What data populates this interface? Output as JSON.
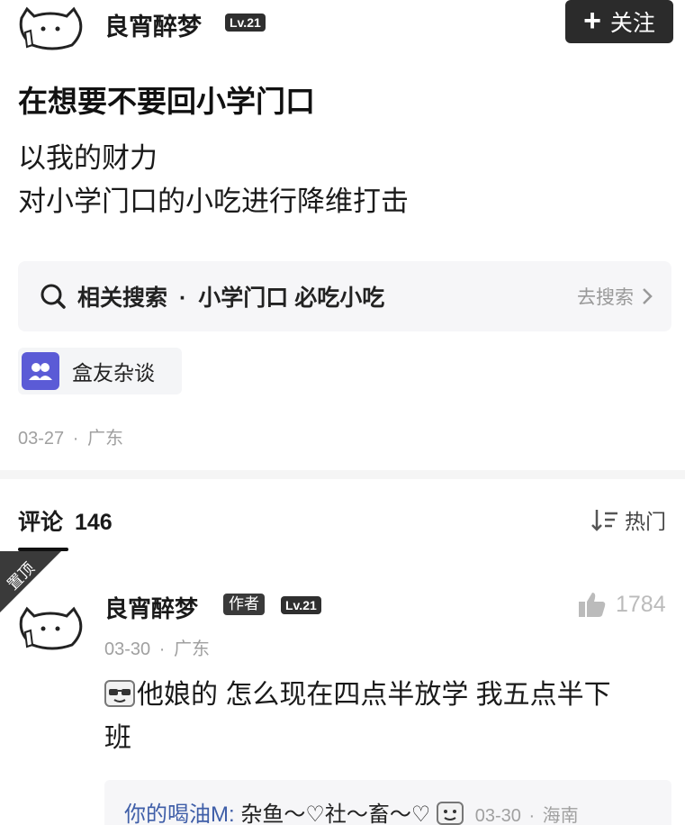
{
  "post": {
    "author": "良宵醉梦",
    "level": "Lv.21",
    "follow_label": "关注",
    "title": "在想要不要回小学门口",
    "body_lines": [
      "以我的财力",
      "对小学门口的小吃进行降维打击"
    ],
    "related_search": {
      "prefix": "相关搜索",
      "separator": "·",
      "query": "小学门口 必吃小吃",
      "action": "去搜索"
    },
    "topic": "盒友杂谈",
    "date": "03-27",
    "location": "广东",
    "meta_sep": "·"
  },
  "comments": {
    "label": "评论",
    "count": "146",
    "sort_label": "热门",
    "pinned_label": "置顶",
    "items": [
      {
        "author": "良宵醉梦",
        "author_tag": "作者",
        "level": "Lv.21",
        "likes": "1784",
        "date": "03-30",
        "location": "广东",
        "text_line1": "他娘的 怎么现在四点半放学 我五点半下",
        "text_line2": "班",
        "reply": {
          "user": "你的喝油M:",
          "text": "杂鱼～♡社～畜～♡",
          "date": "03-30",
          "location": "海南"
        }
      }
    ]
  },
  "colors": {
    "topic_icon_bg": "#5b5bd6",
    "reply_user": "#3f5ea8",
    "follow_bg": "#2b2b2b"
  }
}
